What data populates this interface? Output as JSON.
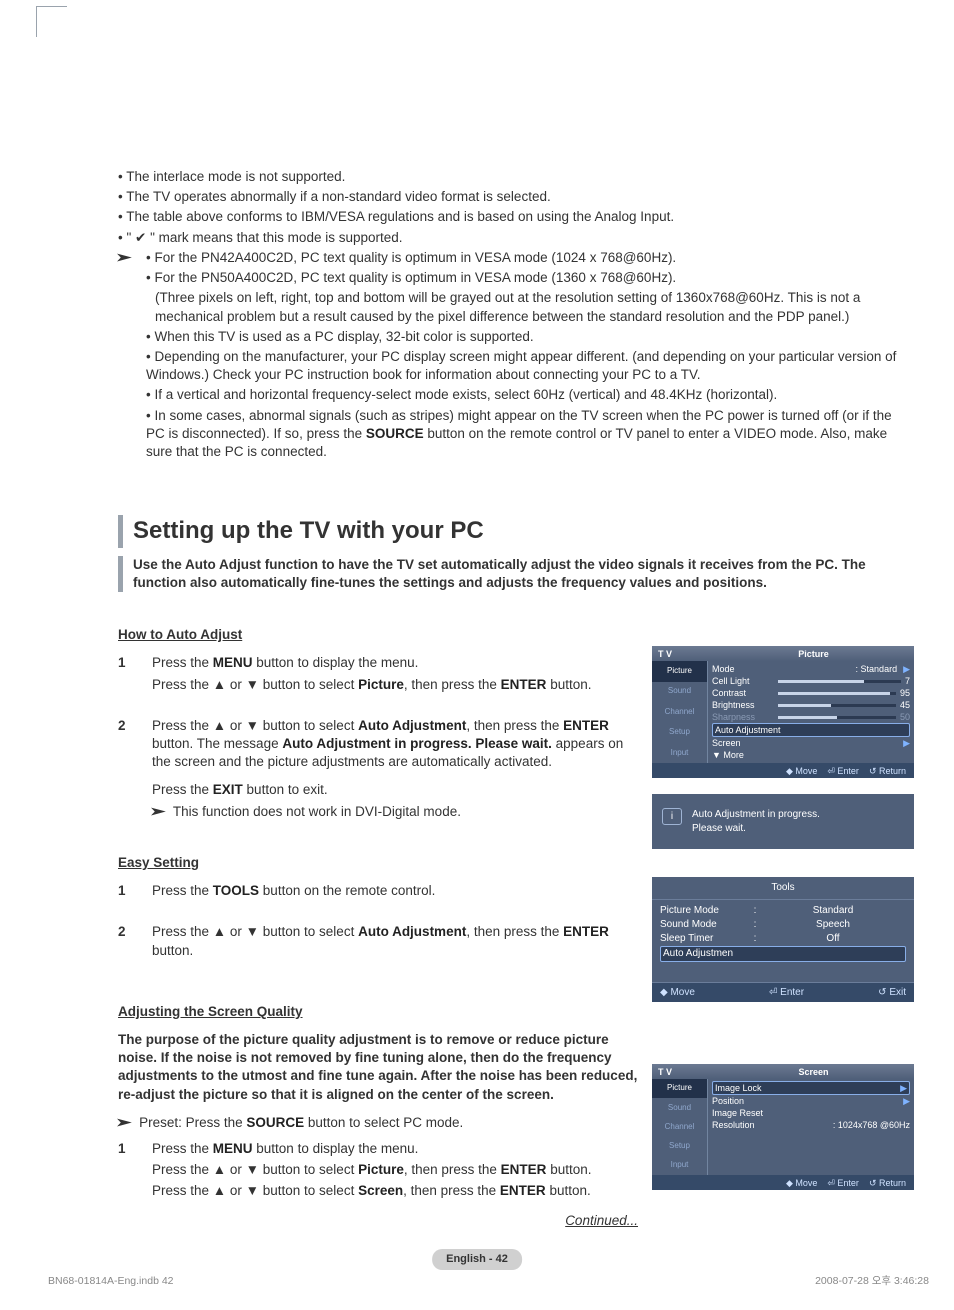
{
  "bullets": {
    "b1": "The interlace mode is not supported.",
    "b2": "The TV operates abnormally if a non-standard video format is selected.",
    "b3": "The table above conforms to IBM/VESA regulations and is based on using the Analog Input.",
    "b4_pre": "\" ",
    "b4_post": " \" mark means that this mode is supported.",
    "sb1": "For the PN42A400C2D, PC text quality is optimum in VESA mode (1024 x 768@60Hz).",
    "sb2": "For the PN50A400C2D, PC text quality is optimum in VESA mode (1360 x 768@60Hz).",
    "sb2b": "(Three pixels on left, right, top and bottom will be grayed out at the resolution setting of 1360x768@60Hz. This is not a mechanical problem but a result caused by the pixel difference between the standard resolution and the PDP panel.)",
    "sb3": "When this TV is used as a PC display, 32-bit color is supported.",
    "sb4": "Depending on the manufacturer, your PC display screen might appear different. (and depending on your particular version of Windows.) Check your PC instruction book for information about connecting your PC to a TV.",
    "sb5": "If a vertical and horizontal frequency-select mode exists, select 60Hz (vertical) and 48.4KHz (horizontal).",
    "sb6a": "In some cases, abnormal signals (such as stripes) might appear on the TV screen when the PC power is turned off (or if the PC is disconnected). If so, press the ",
    "sb6b": "SOURCE",
    "sb6c": " button on the remote control or TV panel to enter a VIDEO mode. Also, make sure that the PC is connected."
  },
  "section": {
    "title": "Setting up the TV with your PC",
    "intro": "Use the Auto Adjust function to have the TV set automatically adjust the video signals it receives from the PC. The function also automatically fine-tunes the settings and adjusts the frequency values and positions."
  },
  "howto": {
    "head": "How to Auto Adjust",
    "s1a": "Press the ",
    "s1b": "MENU",
    "s1c": " button to display the menu.",
    "s1d": "Press the ▲ or ▼ button to select ",
    "s1e": "Picture",
    "s1f": ", then press the ",
    "s1g": "ENTER",
    "s1h": " button.",
    "s2a": "Press the ▲ or ▼ button to select ",
    "s2b": "Auto Adjustment",
    "s2c": ", then press the ",
    "s2d": "ENTER",
    "s2e": " button. The message ",
    "s2f": "Auto Adjustment in progress. Please wait.",
    "s2g": " appears on the screen and the picture adjustments are automatically activated.",
    "s2h": "Press the ",
    "s2i": "EXIT",
    "s2j": " button to exit.",
    "s2k": "This function does not work in DVI-Digital mode."
  },
  "easy": {
    "head": "Easy Setting",
    "s1a": "Press the ",
    "s1b": "TOOLS",
    "s1c": " button on the remote control.",
    "s2a": "Press the ▲ or ▼ button to select ",
    "s2b": "Auto Adjustment",
    "s2c": ", then press the ",
    "s2d": "ENTER",
    "s2e": " button."
  },
  "adjust": {
    "head": "Adjusting the Screen Quality",
    "para": "The purpose of the picture quality adjustment is to remove or reduce picture noise. If the noise is not removed by fine tuning alone, then do the frequency adjustments to the utmost and fine tune again. After the noise has been reduced, re-adjust the picture so that it is aligned on the center of the screen.",
    "preset_a": "Preset: Press the ",
    "preset_b": "SOURCE",
    "preset_c": " button to select PC mode.",
    "s1a": "Press the ",
    "s1b": "MENU",
    "s1c": " button to display the menu.",
    "s1d": "Press the ▲ or ▼ button to select ",
    "s1e": "Picture",
    "s1f": ", then press the ",
    "s1g": "ENTER",
    "s1h": " button.",
    "s1i": "Press the ▲ or ▼ button to select ",
    "s1j": "Screen",
    "s1k": ", then press the ",
    "s1l": "ENTER",
    "s1m": " button."
  },
  "continued": "Continued...",
  "osd_pic": {
    "tv": "T V",
    "title": "Picture",
    "nav": {
      "picture": "Picture",
      "sound": "Sound",
      "channel": "Channel",
      "setup": "Setup",
      "input": "Input"
    },
    "rows": {
      "mode_l": "Mode",
      "mode_v": ": Standard",
      "cell_l": "Cell Light",
      "cell_v": "7",
      "con_l": "Contrast",
      "con_v": "95",
      "bri_l": "Brightness",
      "bri_v": "45",
      "sha_l": "Sharpness",
      "sha_v": "50",
      "auto": "Auto Adjustment",
      "screen": "Screen",
      "more": "▼ More"
    },
    "btns": {
      "move": "◆ Move",
      "enter": "⏎ Enter",
      "return": "↺ Return"
    }
  },
  "osd_msg": {
    "icon": "i",
    "line1": "Auto Adjustment in progress.",
    "line2": "Please wait."
  },
  "osd_tools": {
    "title": "Tools",
    "pm_l": "Picture Mode",
    "pm_v": "Standard",
    "sm_l": "Sound Mode",
    "sm_v": "Speech",
    "st_l": "Sleep Timer",
    "st_v": "Off",
    "auto": "Auto Adjustmen",
    "move": "◆ Move",
    "enter": "⏎ Enter",
    "exit": "↺ Exit"
  },
  "osd_screen": {
    "tv": "T V",
    "title": "Screen",
    "rows": {
      "il": "Image Lock",
      "pos": "Position",
      "ir": "Image Reset",
      "res_l": "Resolution",
      "res_v": ": 1024x768  @60Hz"
    },
    "btns": {
      "move": "◆ Move",
      "enter": "⏎ Enter",
      "return": "↺ Return"
    }
  },
  "badge": "English - 42",
  "footer_l": "BN68-01814A-Eng.indb   42",
  "footer_r": "2008-07-28   오후 3:46:28"
}
